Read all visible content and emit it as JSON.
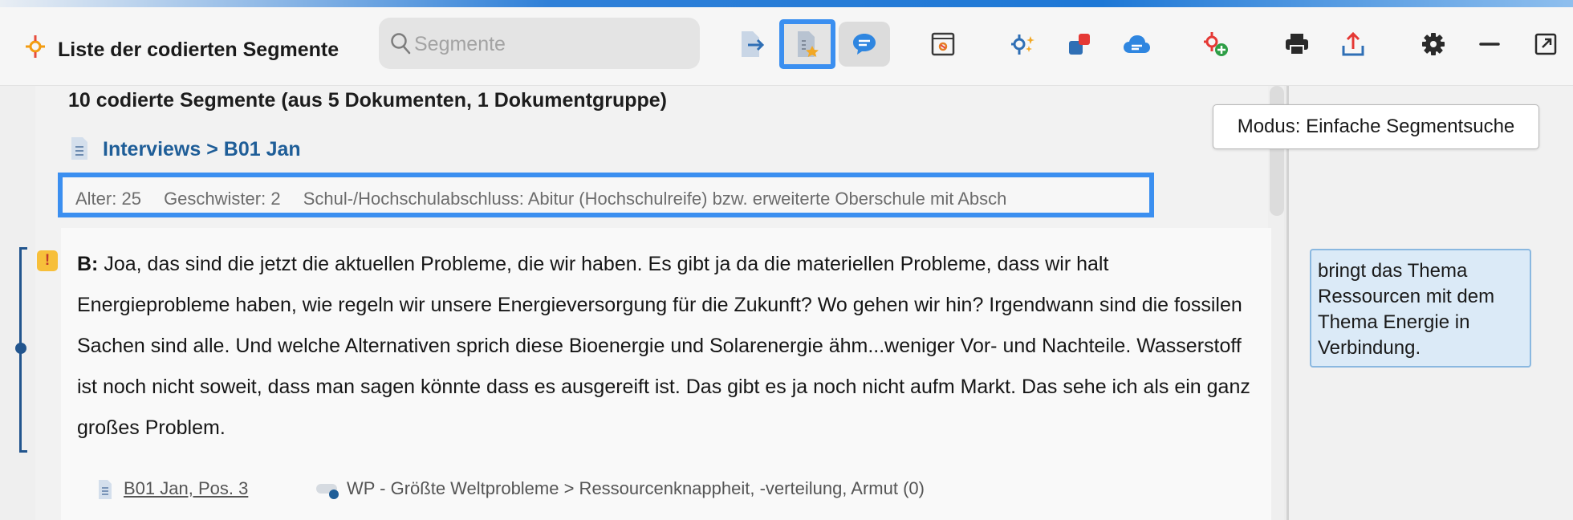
{
  "window": {
    "title": "Liste der codierten Segmente"
  },
  "search": {
    "placeholder": "Segmente",
    "value": ""
  },
  "toolbar": {
    "buttons": [
      {
        "icon": "document-import-icon"
      },
      {
        "icon": "document-favorite-icon",
        "highlighted": true
      },
      {
        "icon": "comment-icon",
        "pressed": true
      },
      {
        "icon": "ai-segment-icon"
      },
      {
        "icon": "code-sparkle-icon"
      },
      {
        "icon": "color-code-icon"
      },
      {
        "icon": "cloud-memo-icon"
      },
      {
        "icon": "add-code-icon"
      },
      {
        "icon": "print-icon"
      },
      {
        "icon": "export-icon"
      },
      {
        "icon": "settings-icon"
      },
      {
        "icon": "minimize-icon"
      },
      {
        "icon": "undock-icon"
      }
    ]
  },
  "summary": "10 codierte Segmente (aus 5 Dokumenten, 1 Dokumentgruppe)",
  "document": {
    "path": "Interviews > B01 Jan"
  },
  "variables": [
    "Alter: 25",
    "Geschwister: 2",
    "Schul-/Hochschulabschluss: Abitur (Hochschulreife) bzw. erweiterte Oberschule mit Absch"
  ],
  "segment": {
    "speaker": "B:",
    "text": "Joa, das sind die jetzt die aktuellen Probleme, die wir haben. Es gibt ja da die materiellen Probleme, dass wir halt Energieprobleme haben, wie regeln wir unsere Energieversorgung für die Zukunft? Wo gehen wir hin? Irgendwann sind die fossilen Sachen sind alle. Und welche Alternativen sprich diese Bioenergie und Solarenergie ähm...weniger Vor- und Nachteile. Wasserstoff ist noch nicht soweit, dass man sagen könnte dass es ausgereift ist. Das gibt es ja noch nicht aufm Markt. Das sehe ich als ein ganz großes Problem.",
    "source": "B01 Jan, Pos. 3",
    "code": "WP - Größte Weltprobleme > Ressourcenknappheit, -verteilung, Armut",
    "code_count": "(0)",
    "priority_symbol": "!"
  },
  "tooltip": "Modus: Einfache Segmentsuche",
  "memo": "bringt das Thema Ressourcen mit dem Thema Energie in Verbindung.",
  "colors": {
    "accent": "#3b8ff0",
    "link": "#1f5e98",
    "bracket": "#22558e",
    "memo_bg": "#dbeaf7",
    "priority": "#f7bf3a"
  }
}
